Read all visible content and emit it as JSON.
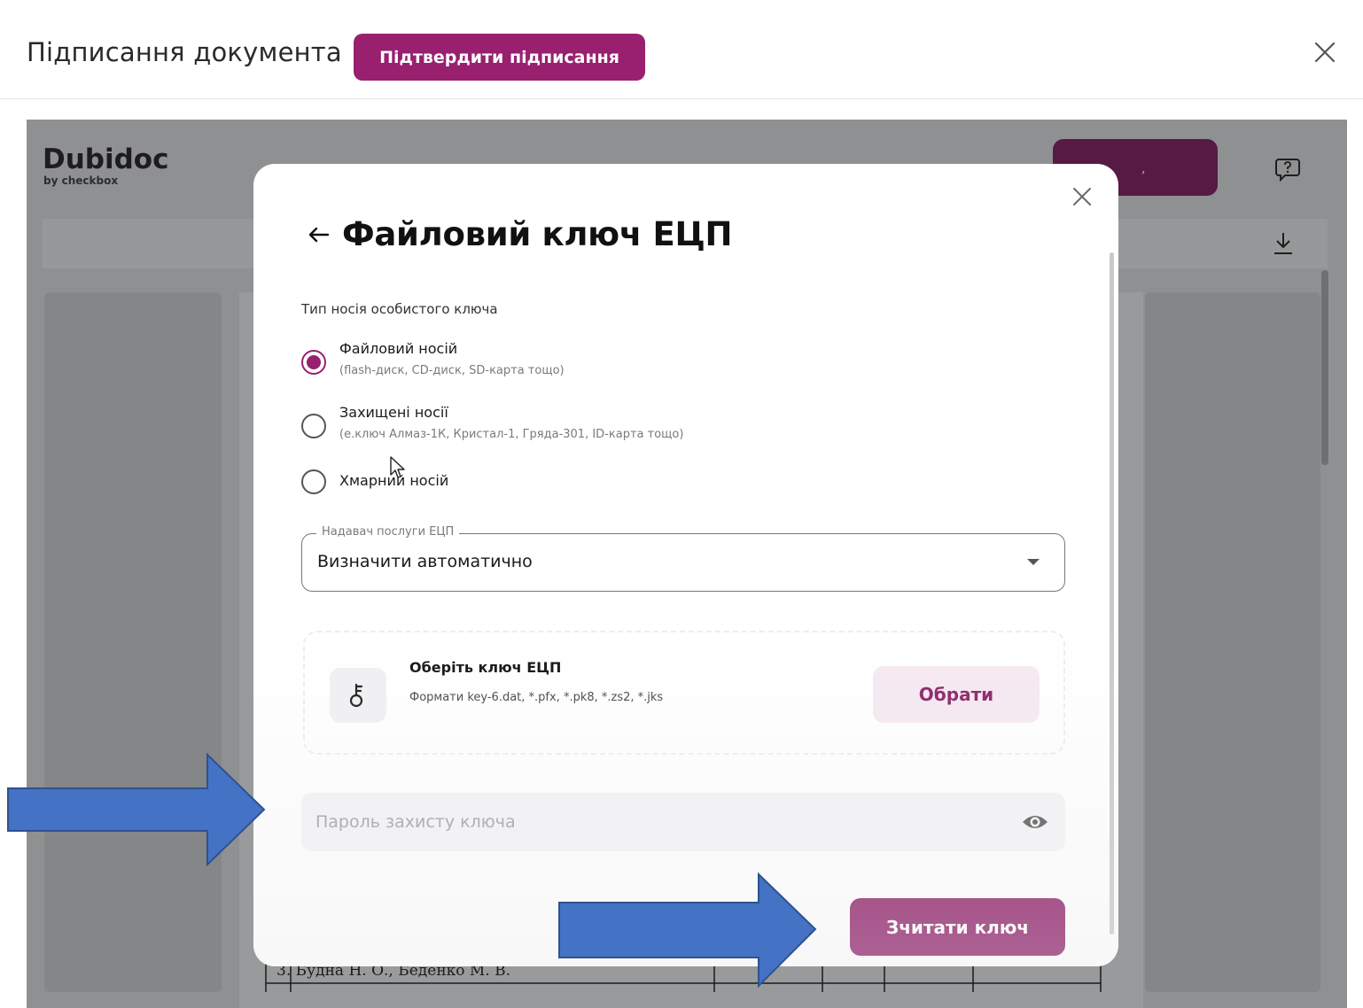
{
  "topbar": {
    "title": "Підписання документа",
    "confirm_label": "Підтвердити підписання"
  },
  "background": {
    "brand_name": "Dubidoc",
    "brand_sub": "by checkbox",
    "purple_button_text": ",",
    "table_row_text": "3.  Будна Н. О., Беденко М. В."
  },
  "modal": {
    "title": "Файловий ключ ЕЦП",
    "key_type_label": "Тип носія особистого ключа",
    "options": [
      {
        "label": "Файловий носій",
        "sub": "(flash-диск, CD-диск, SD-карта тощо)",
        "checked": true
      },
      {
        "label": "Захищені носії",
        "sub": "(е.ключ Алмаз-1К, Кристал-1, Гряда-301, ID-карта тощо)",
        "checked": false
      },
      {
        "label": "Хмарний носій",
        "sub": "",
        "checked": false
      }
    ],
    "provider": {
      "legend": "Надавач послуги ЕЦП",
      "value": "Визначити автоматично"
    },
    "key_card": {
      "title": "Оберіть ключ ЕЦП",
      "formats": "Формати key-6.dat, *.pfx, *.pk8, *.zs2, *.jks",
      "choose_label": "Обрати"
    },
    "password_placeholder": "Пароль захисту ключа",
    "read_label": "Зчитати ключ"
  },
  "colors": {
    "accent": "#98206f",
    "annotation_arrow": "#4472c4",
    "overlay": "#8f9091"
  },
  "icons": [
    "close-icon",
    "help-icon",
    "download-icon",
    "back-arrow-icon",
    "key-icon",
    "eye-icon",
    "chevron-down-icon",
    "mouse-cursor-icon",
    "annotation-arrow-icon"
  ]
}
